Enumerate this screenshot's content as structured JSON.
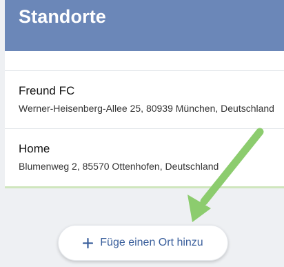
{
  "header": {
    "title": "Standorte"
  },
  "locations": [
    {
      "name": "Freund FC",
      "address": "Werner-Heisenberg-Allee 25, 80939 München, Deutschland"
    },
    {
      "name": "Home",
      "address": "Blumenweg 2, 85570 Ottenhofen, Deutschland"
    }
  ],
  "add_button": {
    "label": "Füge einen Ort hinzu",
    "icon": "plus-icon"
  },
  "colors": {
    "header_bg": "#6b87b8",
    "accent": "#3a5f9c",
    "annotation_arrow": "#8ccc6e"
  },
  "annotation": {
    "icon": "arrow-annotation"
  }
}
